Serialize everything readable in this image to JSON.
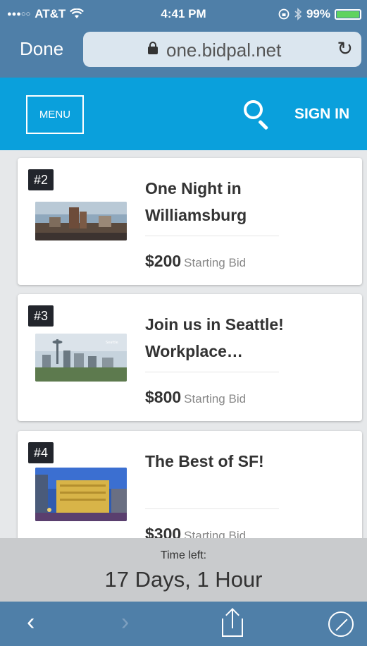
{
  "status_bar": {
    "signal": "●●●○○",
    "carrier": "AT&T",
    "wifi_icon": "wifi-icon",
    "time": "4:41 PM",
    "lock_rotation_icon": "rotation-lock-icon",
    "bluetooth_icon": "bluetooth-icon",
    "battery": "99%",
    "battery_color": "#5fd35f"
  },
  "browser": {
    "done_label": "Done",
    "url": "one.bidpal.net",
    "lock_icon": "lock-icon",
    "reload_glyph": "↻"
  },
  "site_header": {
    "menu_label": "MENU",
    "signin_label": "SIGN IN",
    "accent_color": "#0aa0dc"
  },
  "items": [
    {
      "lot": "#2",
      "title_line1": "One Night in",
      "title_line2": "Williamsburg",
      "price": "$200",
      "price_label": "Starting Bid"
    },
    {
      "lot": "#3",
      "title_line1": "Join us in Seattle!",
      "title_line2": "Workplace…",
      "price": "$800",
      "price_label": "Starting Bid"
    },
    {
      "lot": "#4",
      "title_line1": "The Best of SF!",
      "title_line2": "",
      "price": "$300",
      "price_label": "Starting Bid"
    }
  ],
  "time_left": {
    "label": "Time left:",
    "value": "17 Days, 1 Hour"
  },
  "toolbar": {
    "back_glyph": "‹",
    "forward_glyph": "›"
  }
}
